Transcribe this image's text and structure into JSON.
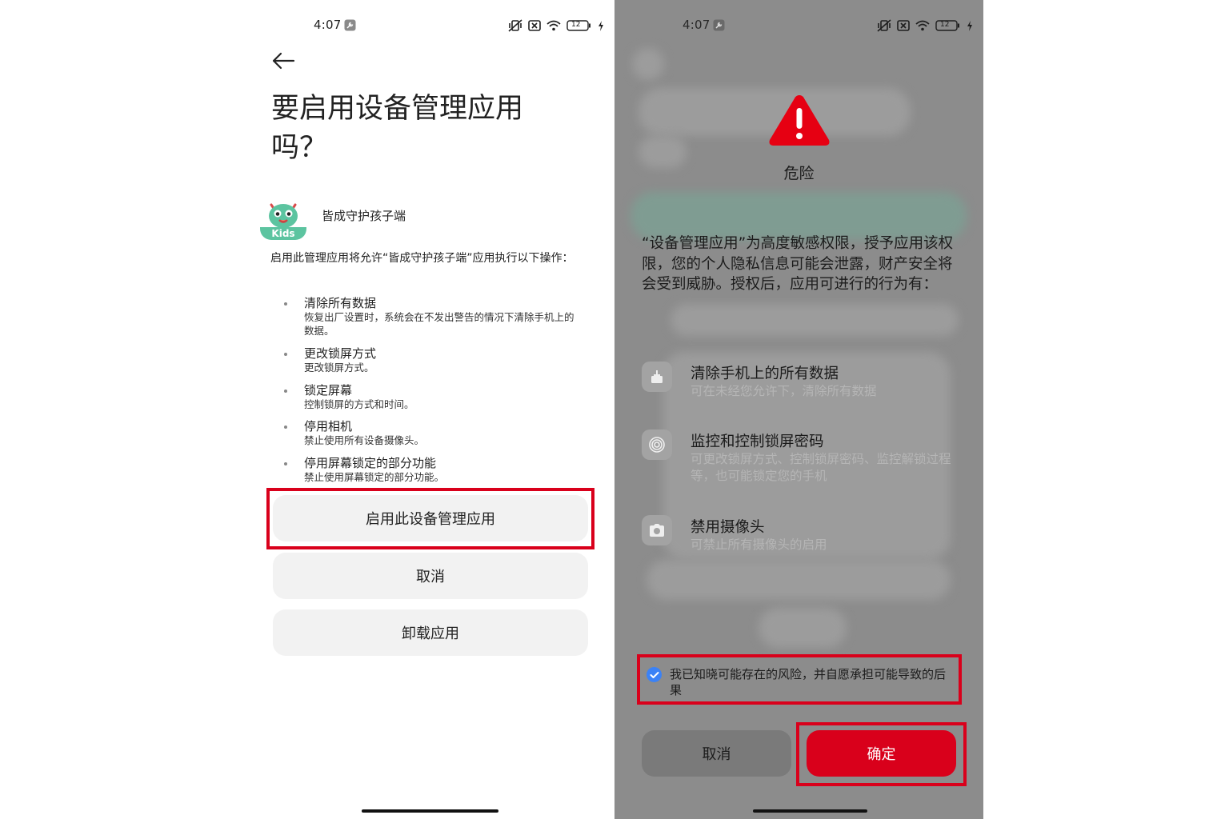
{
  "left": {
    "status": {
      "time": "4:07",
      "battery": "12"
    },
    "title": "要启用设备管理应用吗？",
    "app": {
      "name": "皆成守护孩子端",
      "icon_badge": "Kids"
    },
    "description": "启用此管理应用将允许“皆成守护孩子端”应用执行以下操作：",
    "policies": [
      {
        "title": "清除所有数据",
        "desc": "恢复出厂设置时，系统会在不发出警告的情况下清除手机上的数据。"
      },
      {
        "title": "更改锁屏方式",
        "desc": "更改锁屏方式。"
      },
      {
        "title": "锁定屏幕",
        "desc": "控制锁屏的方式和时间。"
      },
      {
        "title": "停用相机",
        "desc": "禁止使用所有设备摄像头。"
      },
      {
        "title": "停用屏幕锁定的部分功能",
        "desc": "禁止使用屏幕锁定的部分功能。"
      }
    ],
    "buttons": {
      "activate": "启用此设备管理应用",
      "cancel": "取消",
      "uninstall": "卸载应用"
    }
  },
  "right": {
    "status": {
      "time": "4:07",
      "battery": "12"
    },
    "dialog": {
      "title": "危险",
      "description": "“设备管理应用”为高度敏感权限，授予应用该权限，您的个人隐私信息可能会泄露，财产安全将会受到威胁。授权后，应用可进行的行为有：",
      "permissions": [
        {
          "icon": "eraser-icon",
          "title": "清除手机上的所有数据",
          "desc": "可在未经您允许下，清除所有数据"
        },
        {
          "icon": "fingerprint-icon",
          "title": "监控和控制锁屏密码",
          "desc": "可更改锁屏方式、控制锁屏密码、监控解锁过程等，也可能锁定您的手机"
        },
        {
          "icon": "camera-icon",
          "title": "禁用摄像头",
          "desc": "可禁止所有摄像头的启用"
        }
      ],
      "consent": {
        "checked": true,
        "text": "我已知晓可能存在的风险，并自愿承担可能导致的后果"
      },
      "buttons": {
        "cancel": "取消",
        "confirm": "确定"
      }
    }
  },
  "colors": {
    "highlight": "#d9001b",
    "confirm": "#d9001b",
    "checkbox": "#3b82f6",
    "warning": "#e60012"
  }
}
